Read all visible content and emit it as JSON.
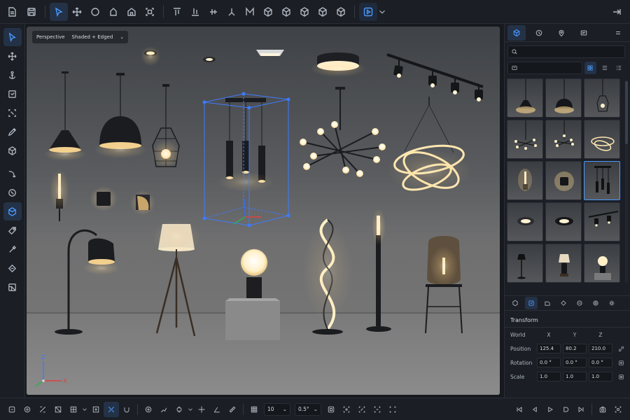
{
  "viewport": {
    "projection": "Perspective",
    "shading": "Shaded + Edged"
  },
  "asset_browser": {
    "search_placeholder": "",
    "filter_value": "",
    "thumbnails": [
      "pendant-cone",
      "pendant-dome",
      "pendant-cage",
      "chandelier-sputnik",
      "chandelier-sputnik-small",
      "chandelier-rings",
      "wall-sconce-tube",
      "wall-sconce-cylinder",
      "pendant-trio",
      "ceiling-downlight",
      "ceiling-flush",
      "track-light",
      "floor-lamp",
      "table-lamp",
      "globe-lamp"
    ],
    "selected_index": 8
  },
  "transform": {
    "title": "Transform",
    "space": "World",
    "axes": [
      "X",
      "Y",
      "Z"
    ],
    "position": {
      "label": "Position",
      "x": "125.4",
      "y": "80.2",
      "z": "210.0"
    },
    "rotation": {
      "label": "Rotation",
      "x": "0.0 °",
      "y": "0.0 °",
      "z": "0.0 °"
    },
    "scale": {
      "label": "Scale",
      "x": "1.0",
      "y": "1.0",
      "z": "1.0"
    }
  },
  "bottom": {
    "grid_size": "10",
    "snap_value": "0.5°"
  },
  "gizmo": {
    "x": "X",
    "y": "Y",
    "z": "Z"
  },
  "colors": {
    "accent": "#4a9bff",
    "panel": "#1b1e24",
    "selection": "#3d7bff"
  }
}
